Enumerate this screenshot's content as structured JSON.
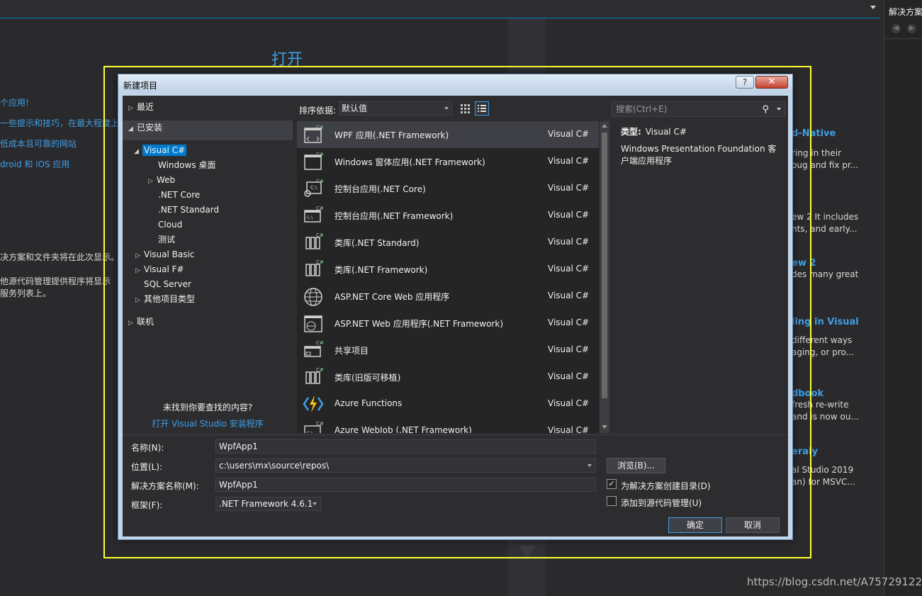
{
  "background": {
    "open_heading": "打开",
    "links": [
      "个应用!",
      "一些提示和技巧，在最大程度上",
      "低成本且可靠的网站",
      "droid 和 iOS 应用"
    ],
    "texts": [
      "决方案和文件夹将在此次显示。",
      "他源代码管理提供程序将显示",
      "服务列表上。"
    ],
    "news": [
      {
        "title": "d-Native",
        "lines": [
          "ring in their",
          "oug and fix pr..."
        ]
      },
      {
        "title": "",
        "lines": [
          "ew 2 It includes",
          "nts, and early..."
        ]
      },
      {
        "title": "ew 2",
        "lines": [
          "des many great"
        ]
      },
      {
        "title": "ling in Visual",
        "lines": [
          "different ways",
          "aging, or pro..."
        ]
      },
      {
        "title": "dbook",
        "lines": [
          "fresh re-write",
          "and is now ou..."
        ]
      },
      {
        "title": "eraly",
        "lines": [
          "al Studio 2019",
          "an) for MSVC..."
        ]
      }
    ],
    "right_panel_title": "解决方案",
    "watermark": "https://blog.csdn.net/A757291228"
  },
  "dialog": {
    "title": "新建项目",
    "help_label": "?",
    "close_label": "✕",
    "tree": {
      "recent": "最近",
      "installed": "已安装",
      "visual_csharp": "Visual C#",
      "windows_desktop": "Windows 桌面",
      "web": "Web",
      "net_core": ".NET Core",
      "net_standard": ".NET Standard",
      "cloud": "Cloud",
      "test": "测试",
      "visual_basic": "Visual Basic",
      "visual_fsharp": "Visual F#",
      "sql_server": "SQL Server",
      "other_types": "其他项目类型",
      "online": "联机"
    },
    "not_found": "未找到你要查找的内容?",
    "installer_link": "打开 Visual Studio 安装程序",
    "sort_label": "排序依据:",
    "sort_value": "默认值",
    "search_placeholder": "搜索(Ctrl+E)",
    "templates": [
      {
        "name": "WPF 应用(.NET Framework)",
        "lang": "Visual C#",
        "icon": "wpf-window-icon"
      },
      {
        "name": "Windows 窗体应用(.NET Framework)",
        "lang": "Visual C#",
        "icon": "winforms-window-icon"
      },
      {
        "name": "控制台应用(.NET Core)",
        "lang": "Visual C#",
        "icon": "console-core-icon"
      },
      {
        "name": "控制台应用(.NET Framework)",
        "lang": "Visual C#",
        "icon": "console-icon"
      },
      {
        "name": "类库(.NET Standard)",
        "lang": "Visual C#",
        "icon": "class-library-icon"
      },
      {
        "name": "类库(.NET Framework)",
        "lang": "Visual C#",
        "icon": "class-library-icon"
      },
      {
        "name": "ASP.NET Core Web 应用程序",
        "lang": "Visual C#",
        "icon": "globe-icon"
      },
      {
        "name": "ASP.NET Web 应用程序(.NET Framework)",
        "lang": "Visual C#",
        "icon": "web-window-icon"
      },
      {
        "name": "共享项目",
        "lang": "Visual C#",
        "icon": "shared-project-icon"
      },
      {
        "name": "类库(旧版可移植)",
        "lang": "Visual C#",
        "icon": "class-library-icon"
      },
      {
        "name": "Azure Functions",
        "lang": "Visual C#",
        "icon": "azure-functions-icon"
      },
      {
        "name": "Azure WebJob (.NET Framework)",
        "lang": "Visual C#",
        "icon": "webjob-icon"
      }
    ],
    "detail": {
      "type_label": "类型:",
      "type_value": "Visual C#",
      "description": "Windows Presentation Foundation 客户端应用程序"
    },
    "form": {
      "name_label": "名称(N):",
      "name_value": "WpfApp1",
      "location_label": "位置(L):",
      "location_value": "c:\\users\\mx\\source\\repos\\",
      "solution_label": "解决方案名称(M):",
      "solution_value": "WpfApp1",
      "framework_label": "框架(F):",
      "framework_value": ".NET Framework 4.6.1",
      "browse_label": "浏览(B)...",
      "create_dir_label": "为解决方案创建目录(D)",
      "create_dir_checked": "✓",
      "add_sc_label": "添加到源代码管理(U)",
      "ok_label": "确定",
      "cancel_label": "取消"
    }
  }
}
